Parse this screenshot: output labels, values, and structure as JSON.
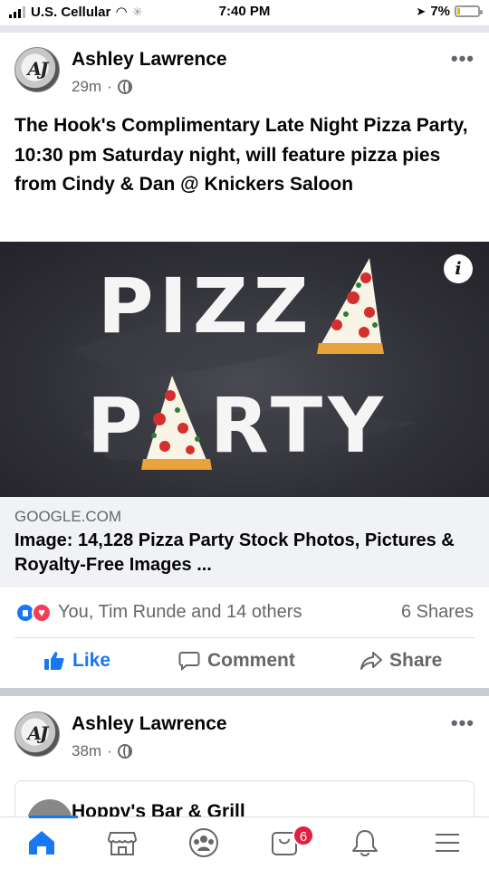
{
  "status_bar": {
    "carrier": "U.S. Cellular",
    "time": "7:40 PM",
    "battery": "7%",
    "battery_level": 0.07
  },
  "post1": {
    "author": "Ashley Lawrence",
    "time": "29m",
    "separator": "·",
    "text": "The Hook's Complimentary Late Night Pizza Party, 10:30 pm Saturday night, will feature pizza pies from Cindy & Dan @ Knickers Saloon",
    "image": {
      "line1": "PIZZ",
      "line2_left": "P",
      "line2_right": "RTY"
    },
    "link": {
      "domain": "GOOGLE.COM",
      "title": "Image: 14,128 Pizza Party Stock Photos, Pictures & Royalty-Free Images ..."
    },
    "reactions_text": "You, Tim Runde and 14 others",
    "shares": "6 Shares",
    "actions": {
      "like": "Like",
      "comment": "Comment",
      "share": "Share"
    }
  },
  "post2": {
    "author": "Ashley Lawrence",
    "time": "38m",
    "separator": "·",
    "link_title": "Hoppy's Bar & Grill"
  },
  "bottom_nav": {
    "notification_count": "6",
    "icons": [
      "home-icon",
      "marketplace-icon",
      "groups-icon",
      "shop-icon",
      "bell-icon",
      "menu-icon"
    ]
  },
  "colors": {
    "brand_blue": "#1877f2",
    "badge_red": "#e41e3f",
    "secondary_text": "#65676b"
  }
}
